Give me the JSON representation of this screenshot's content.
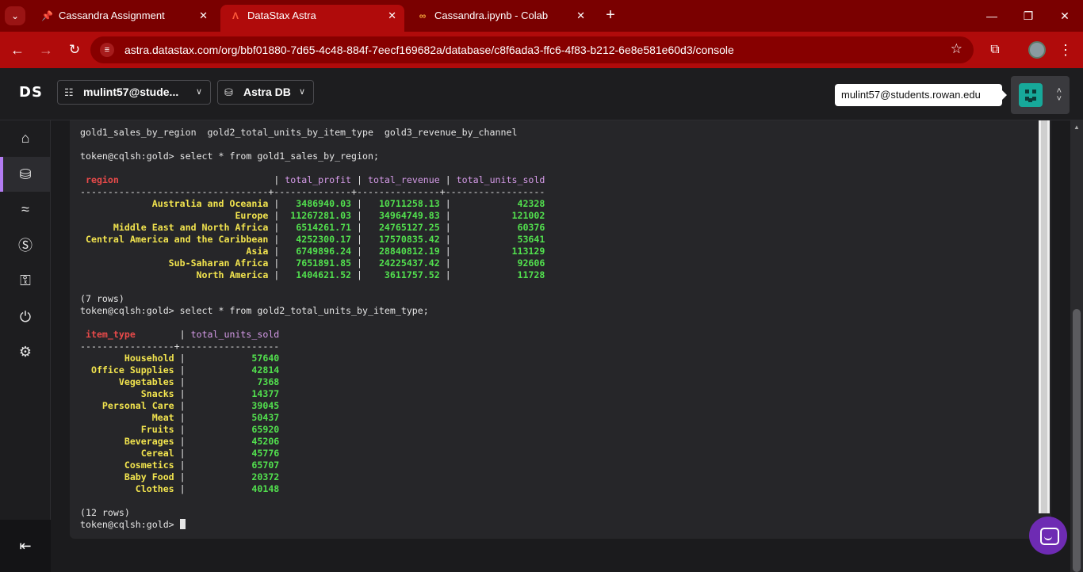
{
  "browser": {
    "tabs": [
      {
        "title": "Cassandra Assignment",
        "icon": "pin-favicon"
      },
      {
        "title": "DataStax Astra",
        "icon": "astra-favicon",
        "active": true
      },
      {
        "title": "Cassandra.ipynb - Colab",
        "icon": "colab-favicon"
      }
    ],
    "url": "astra.datastax.com/org/bbf01880-7d65-4c48-884f-7eecf169682a/database/c8f6ada3-ffc6-4f83-b212-6e8e581e60d3/console",
    "colors": {
      "tabbar": "#7a0000",
      "toolbar": "#b00b0b"
    }
  },
  "app": {
    "logo": "DS",
    "org_selector": "mulint57@stude...",
    "product_selector": "Astra DB",
    "user_tooltip": "mulint57@students.rowan.edu"
  },
  "sidebar": {
    "items": [
      {
        "name": "home-icon"
      },
      {
        "name": "database-icon",
        "active": true
      },
      {
        "name": "streaming-icon"
      },
      {
        "name": "billing-icon"
      },
      {
        "name": "key-icon"
      },
      {
        "name": "plug-icon"
      },
      {
        "name": "settings-icon"
      }
    ]
  },
  "console": {
    "tables_line": "gold1_sales_by_region  gold2_total_units_by_item_type  gold3_revenue_by_channel",
    "prompt1": "token@cqlsh:gold> select * from gold1_sales_by_region;",
    "q1": {
      "headers": [
        "region",
        "total_profit",
        "total_revenue",
        "total_units_sold"
      ],
      "separator": "----------------------------------+--------------+---------------+------------------",
      "rows": [
        [
          "Australia and Oceania",
          "3486940.03",
          "10711258.13",
          "42328"
        ],
        [
          "Europe",
          "11267281.03",
          "34964749.83",
          "121002"
        ],
        [
          "Middle East and North Africa",
          "6514261.71",
          "24765127.25",
          "60376"
        ],
        [
          "Central America and the Caribbean",
          "4252300.17",
          "17570835.42",
          "53641"
        ],
        [
          "Asia",
          "6749896.24",
          "28840812.19",
          "113129"
        ],
        [
          "Sub-Saharan Africa",
          "7651891.85",
          "24225437.42",
          "92606"
        ],
        [
          "North America",
          "1404621.52",
          "3611757.52",
          "11728"
        ]
      ],
      "row_count": "(7 rows)"
    },
    "prompt2": "token@cqlsh:gold> select * from gold2_total_units_by_item_type;",
    "q2": {
      "headers": [
        "item_type",
        "total_units_sold"
      ],
      "separator": "-----------------+------------------",
      "rows": [
        [
          "Household",
          "57640"
        ],
        [
          "Office Supplies",
          "42814"
        ],
        [
          "Vegetables",
          "7368"
        ],
        [
          "Snacks",
          "14377"
        ],
        [
          "Personal Care",
          "39045"
        ],
        [
          "Meat",
          "50437"
        ],
        [
          "Fruits",
          "65920"
        ],
        [
          "Beverages",
          "45206"
        ],
        [
          "Cereal",
          "45776"
        ],
        [
          "Cosmetics",
          "65707"
        ],
        [
          "Baby Food",
          "20372"
        ],
        [
          "Clothes",
          "40148"
        ]
      ],
      "row_count": "(12 rows)"
    },
    "final_prompt": "token@cqlsh:gold> ",
    "colors": {
      "header": "#e94a4a",
      "key": "#f2e44e",
      "value": "#52e04e"
    }
  }
}
